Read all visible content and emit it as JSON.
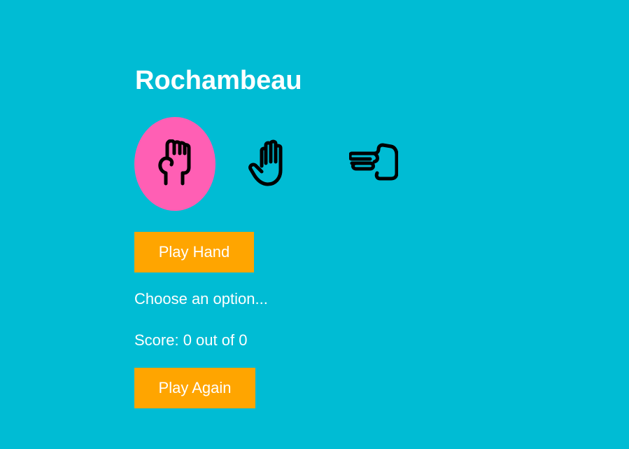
{
  "title": "Rochambeau",
  "choices": [
    {
      "name": "rock",
      "icon": "fist-icon",
      "selected": true
    },
    {
      "name": "paper",
      "icon": "open-hand-icon",
      "selected": false
    },
    {
      "name": "scissors",
      "icon": "two-fingers-icon",
      "selected": false
    }
  ],
  "buttons": {
    "play_hand": "Play Hand",
    "play_again": "Play Again"
  },
  "status": "Choose an option...",
  "score": {
    "label": "Score: 0 out of 0"
  },
  "colors": {
    "background": "#00bcd4",
    "button": "#ffa500",
    "selected": "#ff5fb4",
    "text": "#ffffff"
  }
}
